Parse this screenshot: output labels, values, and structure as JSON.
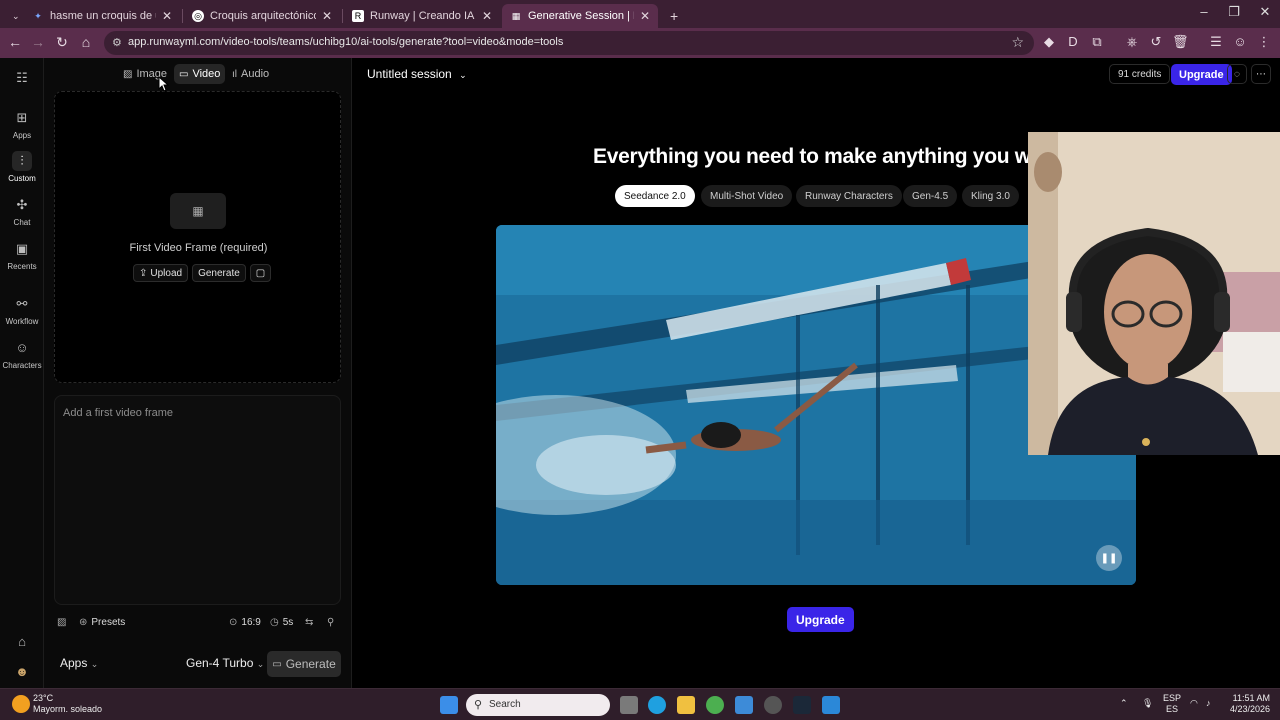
{
  "browser": {
    "tabs": [
      {
        "title": "hasme un croquis de una canch",
        "active": false
      },
      {
        "title": "Croquis arquitectónico diseño",
        "active": false
      },
      {
        "title": "Runway | Creando IA para simu",
        "active": false
      },
      {
        "title": "Generative Session | Runway AI",
        "active": true
      }
    ],
    "url": "app.runwayml.com/video-tools/teams/uchibg10/ai-tools/generate?tool=video&mode=tools",
    "new_tab": "+"
  },
  "rail": {
    "items": [
      {
        "label": "Apps"
      },
      {
        "label": "Custom"
      },
      {
        "label": "Chat"
      },
      {
        "label": "Recents"
      },
      {
        "label": "Workflow"
      },
      {
        "label": "Characters"
      }
    ]
  },
  "panel": {
    "mode_tabs": {
      "image": "Image",
      "video": "Video",
      "audio": "Audio"
    },
    "frame_label": "First Video Frame (required)",
    "upload": "Upload",
    "generate_small": "Generate",
    "prompt_placeholder": "Add a first video frame",
    "presets": "Presets",
    "aspect": "16:9",
    "duration": "5s",
    "apps": "Apps",
    "model": "Gen-4 Turbo",
    "generate": "Generate"
  },
  "main": {
    "session_title": "Untitled session",
    "credits": "91 credits",
    "upgrade_top": "Upgrade",
    "hero": "Everything you need to make anything you war",
    "chips": [
      "Seedance 2.0",
      "Multi-Shot Video",
      "Runway Characters",
      "Gen-4.5",
      "Kling 3.0"
    ],
    "upgrade_main": "Upgrade"
  },
  "taskbar": {
    "temp": "23°C",
    "weather": "Mayorm. soleado",
    "search": "Search",
    "lang1": "ESP",
    "lang2": "ES",
    "time": "11:51 AM",
    "date": "4/23/2026"
  },
  "colors": {
    "accent": "#3a25e8",
    "chrome_frame": "#3b1f33",
    "chrome_toolbar": "#5a2d4c"
  }
}
